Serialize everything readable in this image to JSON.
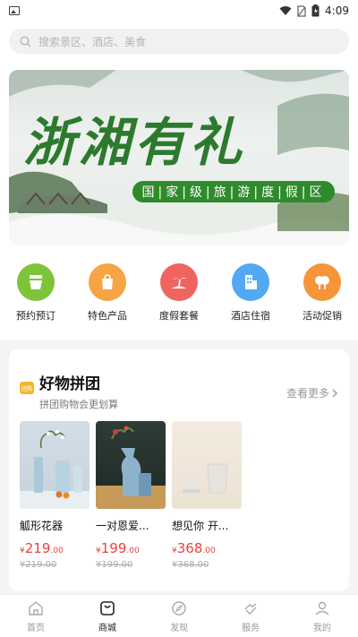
{
  "status_bar": {
    "time": "4:09"
  },
  "search": {
    "placeholder": "搜索景区、酒店、美食"
  },
  "banner": {
    "title": "浙湘有礼",
    "subtitle": "国|家|级|旅|游|度|假|区"
  },
  "categories": [
    {
      "label": "预约预订",
      "color": "#7ec43a",
      "icon": "cup-icon"
    },
    {
      "label": "特色产品",
      "color": "#f6a444",
      "icon": "shopping-bag-icon"
    },
    {
      "label": "度假套餐",
      "color": "#ef6461",
      "icon": "palm-island-icon"
    },
    {
      "label": "酒店住宿",
      "color": "#52a8f2",
      "icon": "building-icon"
    },
    {
      "label": "活动促销",
      "color": "#f4953a",
      "icon": "tree-icon"
    }
  ],
  "group_buy": {
    "badge": "团购",
    "title": "好物拼团",
    "subtitle": "拼团购物会更划算",
    "more": "查看更多",
    "products": [
      {
        "name": "觚形花器",
        "currency": "¥",
        "price_int": "219",
        "price_dec": ".00",
        "original": "¥219.00"
      },
      {
        "name": "一对恩爱...",
        "currency": "¥",
        "price_int": "199",
        "price_dec": ".00",
        "original": "¥199.00"
      },
      {
        "name": "想见你 开...",
        "currency": "¥",
        "price_int": "368",
        "price_dec": ".00",
        "original": "¥368.00"
      }
    ]
  },
  "tabs": [
    {
      "label": "首页",
      "icon": "home-icon",
      "active": false
    },
    {
      "label": "商城",
      "icon": "shop-icon",
      "active": true
    },
    {
      "label": "发现",
      "icon": "discover-icon",
      "active": false
    },
    {
      "label": "服务",
      "icon": "service-icon",
      "active": false
    },
    {
      "label": "我的",
      "icon": "user-icon",
      "active": false
    }
  ],
  "colors": {
    "accent_red": "#e64340",
    "brand_green": "#2f8a2c"
  }
}
